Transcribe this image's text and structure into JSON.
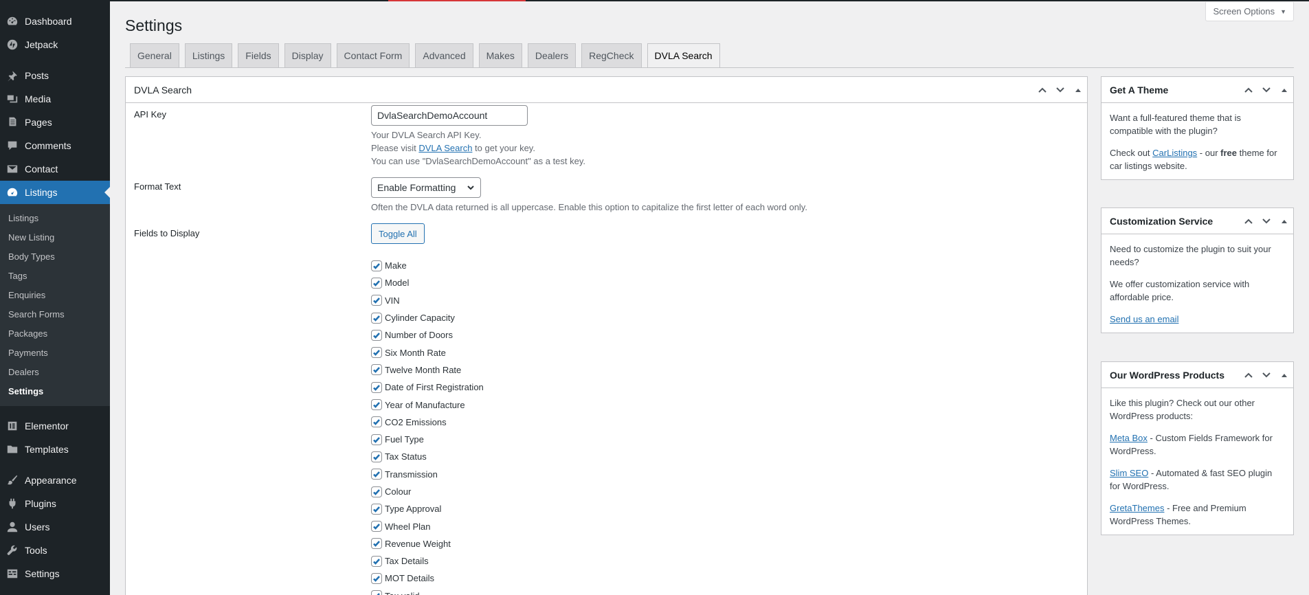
{
  "sidebar": {
    "top_items": [
      {
        "label": "Dashboard",
        "icon": "dashboard-icon"
      },
      {
        "label": "Jetpack",
        "icon": "jetpack-icon"
      }
    ],
    "items_group2": [
      {
        "label": "Posts",
        "icon": "pin-icon"
      },
      {
        "label": "Media",
        "icon": "media-icon"
      },
      {
        "label": "Pages",
        "icon": "pages-icon"
      },
      {
        "label": "Comments",
        "icon": "comments-icon"
      },
      {
        "label": "Contact",
        "icon": "mail-icon"
      }
    ],
    "current_item": {
      "label": "Listings",
      "icon": "car-dashboard-icon"
    },
    "submenu": [
      "Listings",
      "New Listing",
      "Body Types",
      "Tags",
      "Enquiries",
      "Search Forms",
      "Packages",
      "Payments",
      "Dealers",
      "Settings"
    ],
    "active_sub": "Settings",
    "items_group3": [
      {
        "label": "Elementor",
        "icon": "elementor-icon"
      },
      {
        "label": "Templates",
        "icon": "folder-icon"
      }
    ],
    "items_group4": [
      {
        "label": "Appearance",
        "icon": "brush-icon"
      },
      {
        "label": "Plugins",
        "icon": "plugin-icon"
      },
      {
        "label": "Users",
        "icon": "users-icon"
      },
      {
        "label": "Tools",
        "icon": "wrench-icon"
      },
      {
        "label": "Settings",
        "icon": "settings-icon"
      }
    ]
  },
  "screen_options": {
    "label": "Screen Options"
  },
  "page": {
    "title": "Settings"
  },
  "tabs": [
    "General",
    "Listings",
    "Fields",
    "Display",
    "Contact Form",
    "Advanced",
    "Makes",
    "Dealers",
    "RegCheck",
    "DVLA Search"
  ],
  "active_tab": "DVLA Search",
  "main_box": {
    "title": "DVLA Search",
    "api_key": {
      "label": "API Key",
      "value": "DvlaSearchDemoAccount",
      "desc1": "Your DVLA Search API Key.",
      "desc2_pre": "Please visit ",
      "desc2_link": "DVLA Search",
      "desc2_post": " to get your key.",
      "desc3": "You can use \"DvlaSearchDemoAccount\" as a test key."
    },
    "format_text": {
      "label": "Format Text",
      "selected": "Enable Formatting",
      "desc": "Often the DVLA data returned is all uppercase. Enable this option to capitalize the first letter of each word only."
    },
    "fields_to_display": {
      "label": "Fields to Display",
      "toggle_label": "Toggle All",
      "fields": [
        "Make",
        "Model",
        "VIN",
        "Cylinder Capacity",
        "Number of Doors",
        "Six Month Rate",
        "Twelve Month Rate",
        "Date of First Registration",
        "Year of Manufacture",
        "CO2 Emissions",
        "Fuel Type",
        "Tax Status",
        "Transmission",
        "Colour",
        "Type Approval",
        "Wheel Plan",
        "Revenue Weight",
        "Tax Details",
        "MOT Details",
        "Tax valid"
      ]
    }
  },
  "side_boxes": {
    "theme": {
      "title": "Get A Theme",
      "p1": "Want a full-featured theme that is compatible with the plugin?",
      "p2_pre": "Check out ",
      "p2_link": "CarListings",
      "p2_mid": " - our ",
      "p2_bold": "free",
      "p2_post": " theme for car listings website."
    },
    "custom": {
      "title": "Customization Service",
      "p1": "Need to customize the plugin to suit your needs?",
      "p2": "We offer customization service with affordable price.",
      "link": "Send us an email"
    },
    "products": {
      "title": "Our WordPress Products",
      "p1": "Like this plugin? Check out our other WordPress products:",
      "items": [
        {
          "link": "Meta Box",
          "text": " - Custom Fields Framework for WordPress."
        },
        {
          "link": "Slim SEO",
          "text": " - Automated & fast SEO plugin for WordPress."
        },
        {
          "link": "GretaThemes",
          "text": " - Free and Premium WordPress Themes."
        }
      ]
    }
  }
}
